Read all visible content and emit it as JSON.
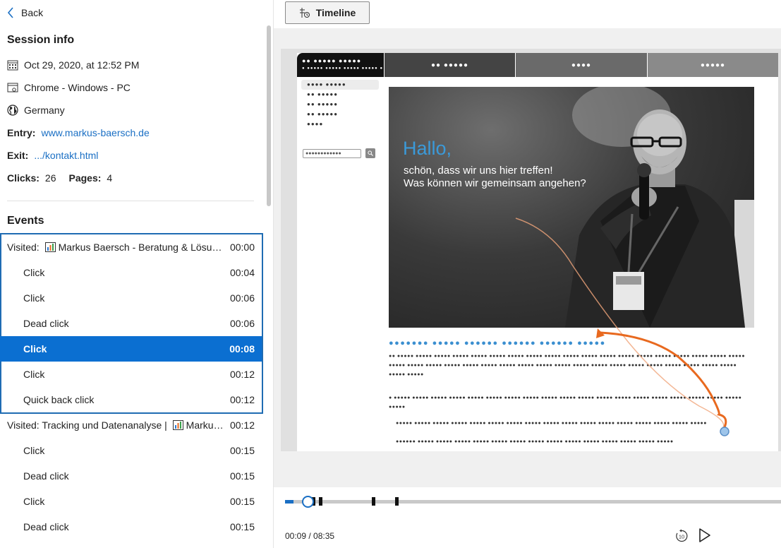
{
  "nav": {
    "back_label": "Back"
  },
  "session": {
    "title": "Session info",
    "date": "Oct 29, 2020, at 12:52 PM",
    "browser": "Chrome - Windows - PC",
    "country": "Germany",
    "entry_label": "Entry:",
    "entry_value": "www.markus-baersch.de",
    "exit_label": "Exit:",
    "exit_value": ".../kontakt.html",
    "clicks_label": "Clicks:",
    "clicks_value": "26",
    "pages_label": "Pages:",
    "pages_value": "4"
  },
  "events": {
    "title": "Events",
    "rows": [
      {
        "kind": "page",
        "prefix": "Visited:",
        "label": "Markus Baersch - Beratung & Lösungen",
        "time": "00:00"
      },
      {
        "kind": "sub",
        "label": "Click",
        "time": "00:04"
      },
      {
        "kind": "sub",
        "label": "Click",
        "time": "00:06"
      },
      {
        "kind": "sub",
        "label": "Dead click",
        "time": "00:06"
      },
      {
        "kind": "sub",
        "label": "Click",
        "time": "00:08",
        "selected": true
      },
      {
        "kind": "sub",
        "label": "Click",
        "time": "00:12"
      },
      {
        "kind": "sub",
        "label": "Quick back click",
        "time": "00:12"
      },
      {
        "kind": "page",
        "prefix": "Visited:",
        "label_before": "Tracking und Datenanalyse |",
        "label_after": "Markus Baersch",
        "time": "00:12"
      },
      {
        "kind": "sub",
        "label": "Click",
        "time": "00:15"
      },
      {
        "kind": "sub",
        "label": "Dead click",
        "time": "00:15"
      },
      {
        "kind": "sub",
        "label": "Click",
        "time": "00:15"
      },
      {
        "kind": "sub",
        "label": "Dead click",
        "time": "00:15"
      }
    ]
  },
  "toolbar": {
    "timeline_label": "Timeline"
  },
  "website": {
    "nav_logo_line1": "●● ●●●●● ●●●●●",
    "nav_logo_line2": "● ●●●●● ●●●●● ●●●●● ●●●●● ●",
    "nav_tabs": [
      "●● ●●●●●",
      "●●●●",
      "●●●●●"
    ],
    "side_items": [
      "●●●● ●●●●●",
      "●● ●●●●●",
      "●● ●●●●●",
      "●● ●●●●●",
      "●●●●"
    ],
    "search_placeholder": "●●●●●●●●●●●●",
    "hero_title": "Hallo,",
    "hero_line1": "schön, dass wir uns hier treffen!",
    "hero_line2": "Was können wir gemeinsam angehen?",
    "heading": "●●●●●●● ●●●●● ●●●●●● ●●●●●● ●●●●●● ●●●●●",
    "para1": "●● ●●●●● ●●●●● ●●●●● ●●●●● ●●●●● ●●●●● ●●●●● ●●●●● ●●●●● ●●●●● ●●●●● ●●●●● ●●●●● ●●●●● ●●●●● ●●●●● ●●●●● ●●●●● ●●●●● ●●●●● ●●●●● ●●●●● ●●●●● ●●●●● ●●●●● ●●●●● ●●●●● ●●●●● ●●●●● ●●●●● ●●●●● ●●●●● ●●●●● ●●●●● ●●●●● ●●●●● ●●●●● ●●●●● ●●●●● ●●●●●",
    "para2": "● ●●●●● ●●●●● ●●●●● ●●●●● ●●●●● ●●●●● ●●●●● ●●●●● ●●●●● ●●●●● ●●●●● ●●●●● ●●●●● ●●●●● ●●●●● ●●●●● ●●●●● ●●●●● ●●●●● ●●●●●",
    "bullet1": "●●●●● ●●●●● ●●●●● ●●●●● ●●●●● ●●●●● ●●●●● ●●●●● ●●●●● ●●●●● ●●●●● ●●●●● ●●●●● ●●●●● ●●●●● ●●●●● ●●●●●",
    "bullet2": "●●●●●● ●●●●● ●●●●● ●●●●● ●●●●● ●●●●● ●●●●● ●●●●● ●●●●● ●●●●● ●●●●● ●●●●● ●●●●● ●●●●● ●●●●●"
  },
  "player": {
    "time": "00:09 / 08:35",
    "progress": 0.017,
    "markers_s": [
      4,
      6,
      8,
      12,
      79,
      104
    ],
    "duration_s": 515,
    "replay_label": "10",
    "accent": "#1a6fc4"
  }
}
